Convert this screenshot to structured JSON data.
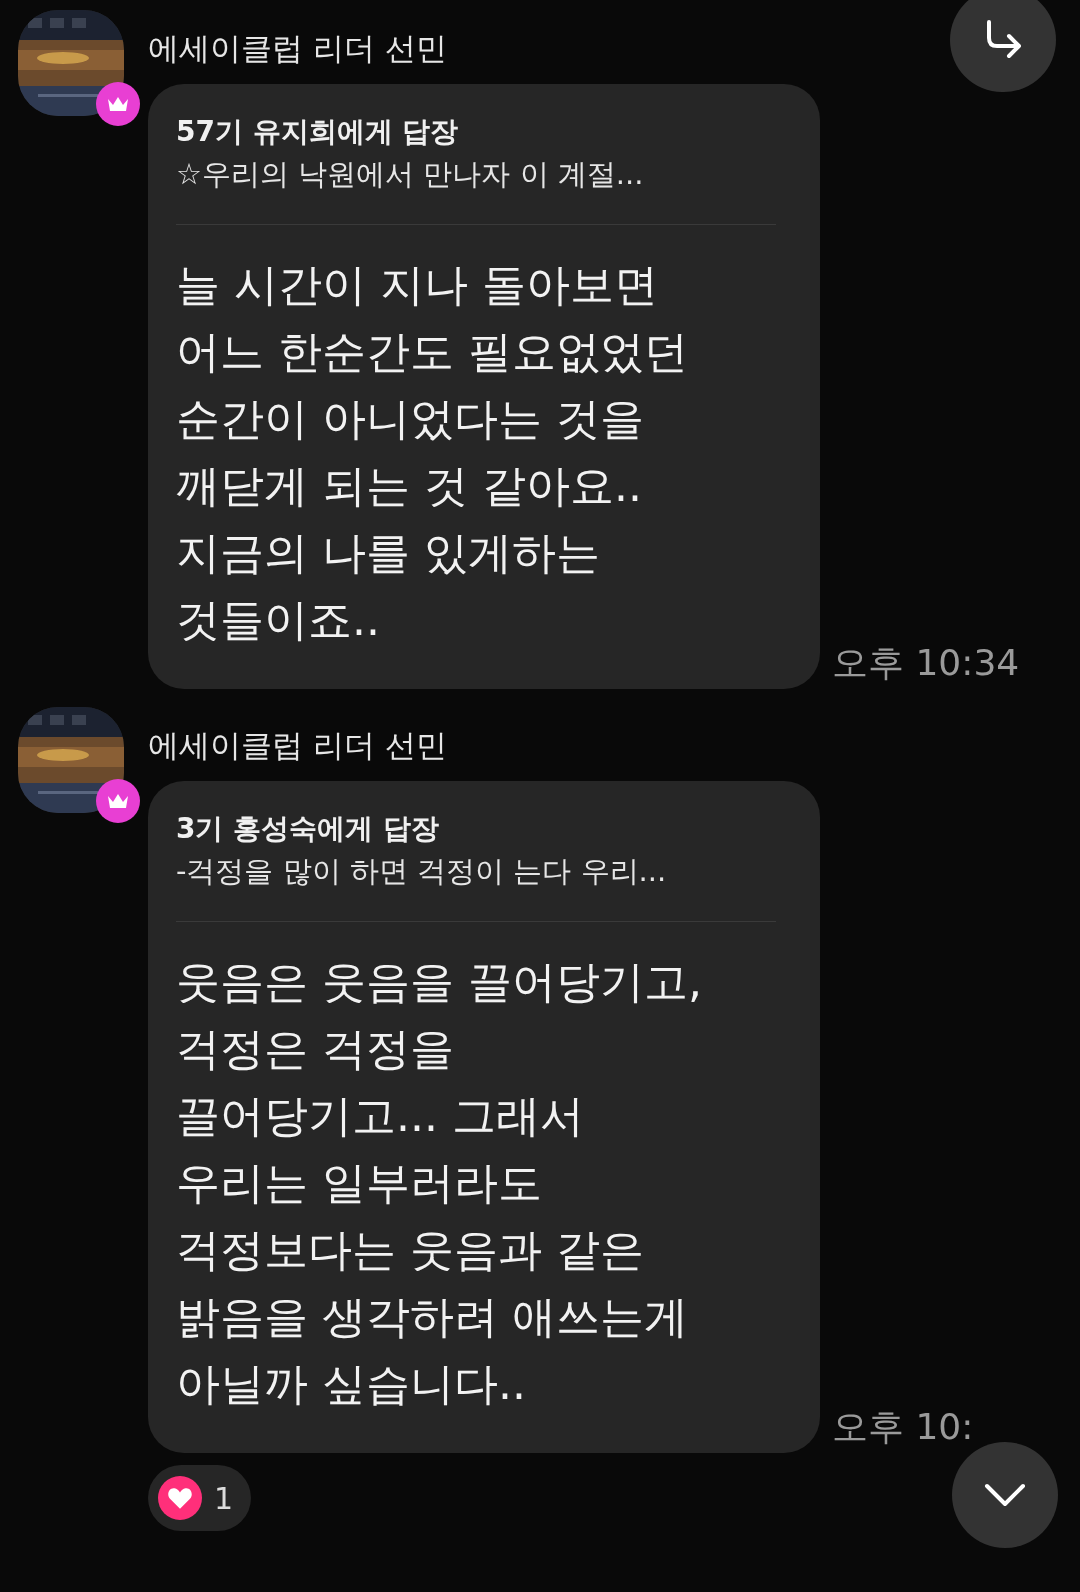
{
  "messages": [
    {
      "sender": "에세이클럽 리더 선민",
      "leader": true,
      "reply_to": "57기 유지희에게 답장",
      "quote": "☆우리의 낙원에서 만나자 이 계절...",
      "body": "늘 시간이 지나 돌아보면\n어느 한순간도 필요없었던\n순간이 아니었다는 것을\n깨닫게 되는 것 같아요..\n지금의 나를 있게하는\n것들이죠..",
      "time": "오후 10:34"
    },
    {
      "sender": "에세이클럽 리더 선민",
      "leader": true,
      "reply_to": "3기 홍성숙에게 답장",
      "quote": "-걱정을 많이 하면 걱정이 는다  우리...",
      "body": "웃음은 웃음을 끌어당기고,\n걱정은 걱정을\n끌어당기고... 그래서\n우리는 일부러라도\n걱정보다는 웃음과 같은\n밝음을 생각하려 애쓰는게\n아닐까 싶습니다..",
      "time": "오후 10:",
      "reactions": [
        {
          "count": "1"
        }
      ]
    }
  ]
}
